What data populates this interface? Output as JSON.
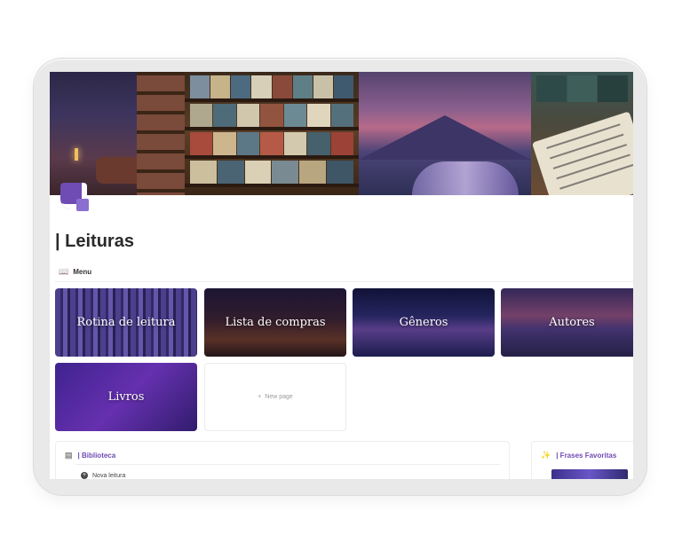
{
  "page": {
    "title": "| Leituras",
    "menu_label": "Menu",
    "menu_icon": "book-icon"
  },
  "gallery": {
    "cards": [
      {
        "label": "Rotina de leitura"
      },
      {
        "label": "Lista de compras"
      },
      {
        "label": "Gêneros"
      },
      {
        "label": "Autores"
      },
      {
        "label": "Livros"
      }
    ],
    "new_page": {
      "icon": "+",
      "label": "New page"
    }
  },
  "biblioteca": {
    "title": "| Biblioteca",
    "icon": "books-icon",
    "new_item_label": "Nova leitura"
  },
  "frases": {
    "title": "| Frases Favoritas",
    "icon": "sparkles-icon"
  },
  "colors": {
    "accent": "#6f4bb4",
    "frame": "#e9e9ea"
  }
}
